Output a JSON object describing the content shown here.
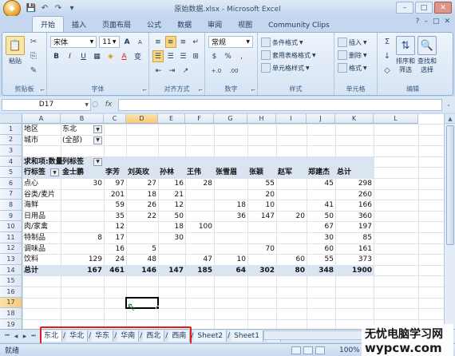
{
  "window": {
    "title": "原始数据.xlsx - Microsoft Excel",
    "minimize": "–",
    "maximize": "□",
    "close": "✕"
  },
  "qat": {
    "save": "💾",
    "undo": "↶",
    "redo": "↷",
    "customize": "▾"
  },
  "ribbon_tabs": [
    "开始",
    "插入",
    "页面布局",
    "公式",
    "数据",
    "审阅",
    "视图",
    "Community Clips"
  ],
  "ribbon_right": {
    "help": "?",
    "min": "–",
    "restore": "□",
    "close": "✕"
  },
  "clipboard": {
    "paste": "粘贴",
    "label": "剪贴板",
    "launcher": "⌐"
  },
  "font": {
    "name": "宋体",
    "size": "11",
    "bold": "B",
    "italic": "I",
    "underline": "U",
    "grow": "A",
    "shrink": "A",
    "font_color": "A",
    "phonetic": "变",
    "label": "字体",
    "launcher": "⌐"
  },
  "alignment": {
    "label": "对齐方式",
    "launcher": "⌐"
  },
  "number": {
    "format": "常规",
    "currency": "$",
    "percent": "%",
    "comma": ",",
    "inc_decimal": "+.0",
    "dec_decimal": ".00",
    "label": "数字",
    "launcher": "⌐"
  },
  "styles": {
    "conditional": "条件格式",
    "table": "套用表格格式",
    "cell": "单元格样式",
    "label": "样式"
  },
  "cells": {
    "insert": "插入",
    "delete": "删除",
    "format": "格式",
    "label": "单元格"
  },
  "editing": {
    "sum": "Σ",
    "fill": "↓",
    "clear": "◇",
    "sort": "排序和\n筛选",
    "sort_l1": "排序和",
    "sort_l2": "筛选",
    "find_l1": "查找和",
    "find_l2": "选择",
    "label": "编辑"
  },
  "formula_bar": {
    "name_box": "D17",
    "fx": "fx",
    "value": ""
  },
  "columns": [
    "A",
    "B",
    "C",
    "D",
    "E",
    "F",
    "G",
    "H",
    "I",
    "J",
    "K",
    "L"
  ],
  "rows": [
    "1",
    "2",
    "3",
    "4",
    "5",
    "6",
    "7",
    "8",
    "9",
    "10",
    "11",
    "12",
    "13",
    "14",
    "15",
    "16",
    "17",
    "18",
    "19"
  ],
  "pivot": {
    "r1": {
      "a": "地区",
      "b": "东北"
    },
    "r2": {
      "a": "城市",
      "b": "(全部)"
    },
    "r4": {
      "a": "求和项:数量",
      "b": "列标签"
    },
    "headers": [
      "行标签",
      "金士鹏",
      "李芳",
      "刘英玫",
      "孙林",
      "王伟",
      "张雪眉",
      "张颖",
      "赵军",
      "郑建杰",
      "总计"
    ],
    "data": [
      [
        "点心",
        "30",
        "97",
        "27",
        "16",
        "28",
        "",
        "55",
        "",
        "45",
        "298"
      ],
      [
        "谷类/麦片",
        "",
        "201",
        "18",
        "21",
        "",
        "",
        "20",
        "",
        "",
        "260"
      ],
      [
        "海鲜",
        "",
        "59",
        "26",
        "12",
        "",
        "18",
        "10",
        "",
        "41",
        "166"
      ],
      [
        "日用品",
        "",
        "35",
        "22",
        "50",
        "",
        "36",
        "147",
        "20",
        "50",
        "360"
      ],
      [
        "肉/家禽",
        "",
        "12",
        "",
        "18",
        "100",
        "",
        "",
        "",
        "67",
        "197"
      ],
      [
        "特制品",
        "8",
        "17",
        "",
        "30",
        "",
        "",
        "",
        "",
        "30",
        "85"
      ],
      [
        "调味品",
        "",
        "16",
        "5",
        "",
        "",
        "",
        "70",
        "",
        "60",
        "161"
      ],
      [
        "饮料",
        "129",
        "24",
        "48",
        "",
        "47",
        "10",
        "",
        "60",
        "55",
        "373"
      ]
    ],
    "total": [
      "总计",
      "167",
      "461",
      "146",
      "147",
      "185",
      "64",
      "302",
      "80",
      "348",
      "1900"
    ]
  },
  "sheets": {
    "list": [
      "东北",
      "华北",
      "华东",
      "华南",
      "西北",
      "西南",
      "Sheet2",
      "Sheet1"
    ],
    "separator": "/",
    "new": "⊕"
  },
  "status": {
    "ready": "就绪",
    "zoom": "100%"
  },
  "watermark": {
    "line1": "无忧电脑学习网",
    "line2": "wypcw.com"
  },
  "accent": {
    "highlight_box": "#e31b1b",
    "pivot_band": "#dbe5f1"
  }
}
